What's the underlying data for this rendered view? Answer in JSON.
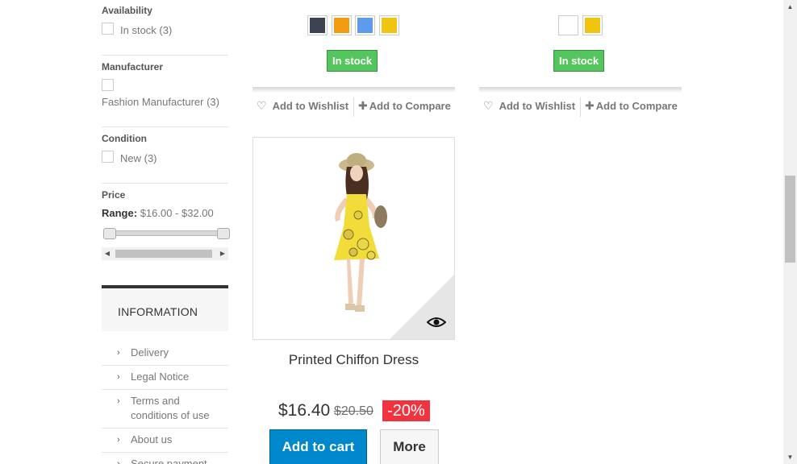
{
  "sidebar": {
    "availability": {
      "title": "Availability",
      "option": "In stock (3)"
    },
    "manufacturer": {
      "title": "Manufacturer",
      "option": "Fashion Manufacturer (3)"
    },
    "condition": {
      "title": "Condition",
      "option": "New (3)"
    },
    "price": {
      "title": "Price",
      "range_label": "Range:",
      "range_value": "$16.00 - $32.00",
      "min": 16,
      "max": 32
    },
    "information": {
      "title": "INFORMATION",
      "links": [
        "Delivery",
        "Legal Notice",
        "Terms and conditions of use",
        "About us",
        "Secure payment"
      ]
    }
  },
  "products_top": [
    {
      "colors": [
        "#3d4350",
        "#f39c11",
        "#5d9cec",
        "#f1c40f"
      ],
      "stock": "In stock",
      "wishlist": "Add to Wishlist",
      "compare": "Add to Compare"
    },
    {
      "colors": [
        "#ffffff",
        "#f1c40f"
      ],
      "stock": "In stock",
      "wishlist": "Add to Wishlist",
      "compare": "Add to Compare"
    }
  ],
  "product": {
    "name": "Printed Chiffon Dress",
    "price": "$16.40",
    "old_price": "$20.50",
    "discount": "-20%",
    "add_to_cart": "Add to cart",
    "more": "More"
  },
  "icons": {
    "wishlist": "heart-icon",
    "compare": "plus-icon",
    "quickview": "eye-icon",
    "chevron": "chevron-right-icon"
  }
}
